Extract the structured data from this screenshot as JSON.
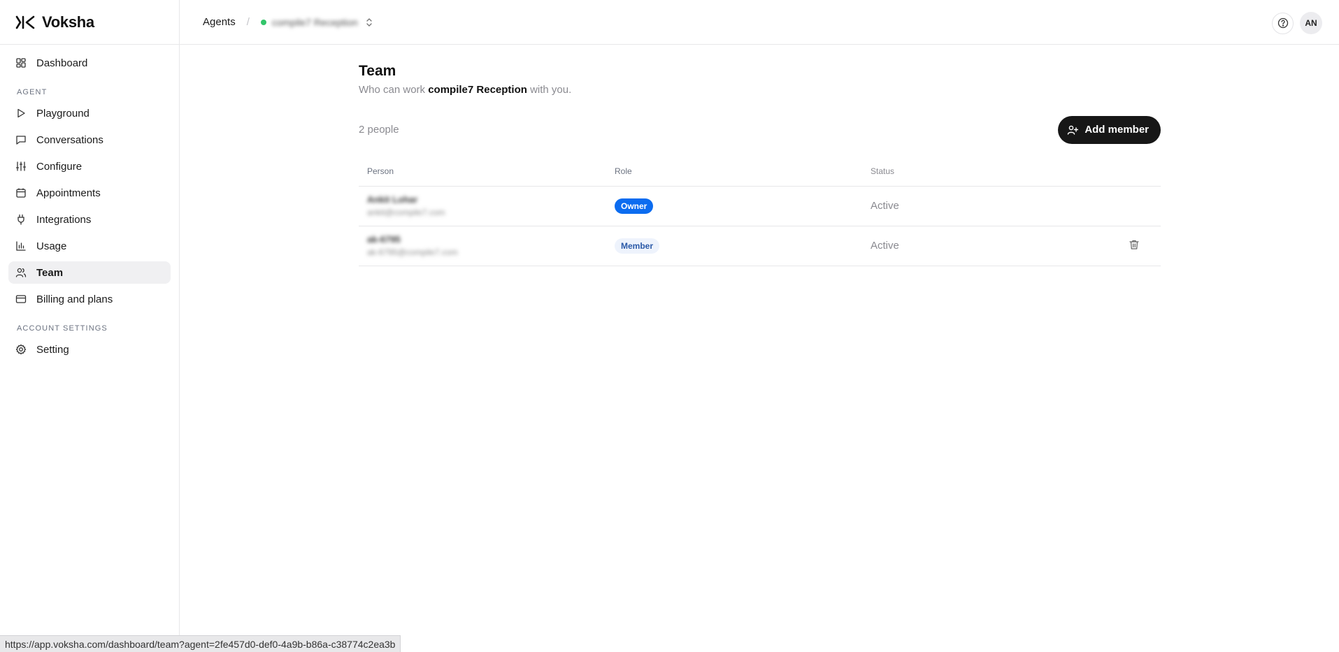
{
  "brand": {
    "name": "Voksha"
  },
  "sidebar": {
    "dashboard": {
      "label": "Dashboard",
      "icon": "dashboard-icon"
    },
    "section_agent": "AGENT",
    "items": [
      {
        "key": "playground",
        "label": "Playground",
        "icon": "play-icon"
      },
      {
        "key": "conversations",
        "label": "Conversations",
        "icon": "chat-icon"
      },
      {
        "key": "configure",
        "label": "Configure",
        "icon": "sliders-icon"
      },
      {
        "key": "appointments",
        "label": "Appointments",
        "icon": "calendar-icon"
      },
      {
        "key": "integrations",
        "label": "Integrations",
        "icon": "plug-icon"
      },
      {
        "key": "usage",
        "label": "Usage",
        "icon": "bar-chart-icon"
      },
      {
        "key": "team",
        "label": "Team",
        "icon": "users-icon",
        "active": true
      },
      {
        "key": "billing",
        "label": "Billing and plans",
        "icon": "credit-card-icon"
      }
    ],
    "section_account": "ACCOUNT SETTINGS",
    "setting": {
      "label": "Setting",
      "icon": "gear-icon"
    }
  },
  "topbar": {
    "breadcrumb_root": "Agents",
    "separator": "/",
    "agent_name": "compile7 Reception",
    "agent_status_color": "#33c56a",
    "avatar_initials": "AN"
  },
  "page": {
    "title": "Team",
    "subtitle_prefix": "Who can work ",
    "subtitle_agent": "compile7 Reception",
    "subtitle_suffix": " with you.",
    "people_count": "2 people",
    "add_button_label": "Add member"
  },
  "table": {
    "columns": [
      "Person",
      "Role",
      "Status"
    ],
    "rows": [
      {
        "name": "Ankit Lohar",
        "email": "ankit@compile7.com",
        "role": "Owner",
        "status": "Active"
      },
      {
        "name": "ak-6795",
        "email": "ak-6795@compile7.com",
        "role": "Member",
        "status": "Active"
      }
    ]
  },
  "statusbar": {
    "url": "https://app.voksha.com/dashboard/team?agent=2fe457d0-def0-4a9b-b86a-c38774c2ea3b"
  },
  "colors": {
    "accent_owner": "#0b6cf0",
    "member_badge_bg": "#eef3fc",
    "primary_button": "#171717"
  }
}
